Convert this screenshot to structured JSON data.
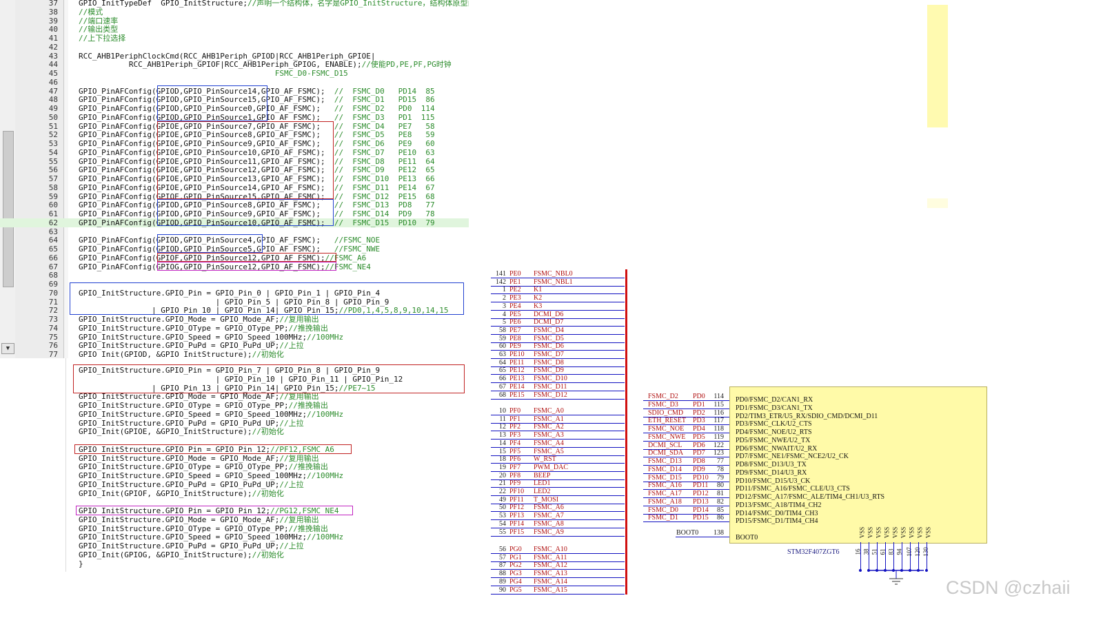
{
  "editor": {
    "lines": [
      {
        "n": "37",
        "code": "GPIO_InitTypeDef  GPIO_InitStructure;",
        "comment": "//声明一个结构体，名字是GPIO_InitStructure，结构体原型由C"
      },
      {
        "n": "38",
        "code": "",
        "comment": "//模式"
      },
      {
        "n": "39",
        "code": "",
        "comment": "//端口速率"
      },
      {
        "n": "40",
        "code": "",
        "comment": "//输出类型"
      },
      {
        "n": "41",
        "code": "",
        "comment": "//上下拉选择"
      },
      {
        "n": "42",
        "code": "",
        "comment": ""
      },
      {
        "n": "43",
        "code": "RCC_AHB1PeriphClockCmd(RCC_AHB1Periph_GPIOD|RCC_AHB1Periph_GPIOE|",
        "comment": ""
      },
      {
        "n": "44",
        "code": "           RCC_AHB1Periph_GPIOF|RCC_AHB1Periph_GPIOG, ENABLE);",
        "comment": "//使能PD,PE,PF,PG时钟"
      },
      {
        "n": "45",
        "code": "",
        "comment": "                                           FSMC_D0-FSMC_D15"
      },
      {
        "n": "46",
        "code": "",
        "comment": ""
      },
      {
        "n": "47",
        "code": "GPIO_PinAFConfig(GPIOD,GPIO_PinSource14,GPIO_AF_FSMC);  ",
        "comment": "//  FSMC_D0   PD14  85"
      },
      {
        "n": "48",
        "code": "GPIO_PinAFConfig(GPIOD,GPIO_PinSource15,GPIO_AF_FSMC);  ",
        "comment": "//  FSMC_D1   PD15  86"
      },
      {
        "n": "49",
        "code": "GPIO_PinAFConfig(GPIOD,GPIO_PinSource0,GPIO_AF_FSMC);   ",
        "comment": "//  FSMC_D2   PD0  114"
      },
      {
        "n": "50",
        "code": "GPIO_PinAFConfig(GPIOD,GPIO_PinSource1,GPIO_AF_FSMC);   ",
        "comment": "//  FSMC_D3   PD1  115"
      },
      {
        "n": "51",
        "code": "GPIO_PinAFConfig(GPIOE,GPIO_PinSource7,GPIO_AF_FSMC);   ",
        "comment": "//  FSMC_D4   PE7   58"
      },
      {
        "n": "52",
        "code": "GPIO_PinAFConfig(GPIOE,GPIO_PinSource8,GPIO_AF_FSMC);   ",
        "comment": "//  FSMC_D5   PE8   59"
      },
      {
        "n": "53",
        "code": "GPIO_PinAFConfig(GPIOE,GPIO_PinSource9,GPIO_AF_FSMC);   ",
        "comment": "//  FSMC_D6   PE9   60"
      },
      {
        "n": "54",
        "code": "GPIO_PinAFConfig(GPIOE,GPIO_PinSource10,GPIO_AF_FSMC);  ",
        "comment": "//  FSMC_D7   PE10  63"
      },
      {
        "n": "55",
        "code": "GPIO_PinAFConfig(GPIOE,GPIO_PinSource11,GPIO_AF_FSMC);  ",
        "comment": "//  FSMC_D8   PE11  64"
      },
      {
        "n": "56",
        "code": "GPIO_PinAFConfig(GPIOE,GPIO_PinSource12,GPIO_AF_FSMC);  ",
        "comment": "//  FSMC_D9   PE12  65"
      },
      {
        "n": "57",
        "code": "GPIO_PinAFConfig(GPIOE,GPIO_PinSource13,GPIO_AF_FSMC);  ",
        "comment": "//  FSMC_D10  PE13  66"
      },
      {
        "n": "58",
        "code": "GPIO_PinAFConfig(GPIOE,GPIO_PinSource14,GPIO_AF_FSMC);  ",
        "comment": "//  FSMC_D11  PE14  67"
      },
      {
        "n": "59",
        "code": "GPIO_PinAFConfig(GPIOE,GPIO_PinSource15,GPIO_AF_FSMC);  ",
        "comment": "//  FSMC_D12  PE15  68"
      },
      {
        "n": "60",
        "code": "GPIO_PinAFConfig(GPIOD,GPIO_PinSource8,GPIO_AF_FSMC);   ",
        "comment": "//  FSMC_D13  PD8   77"
      },
      {
        "n": "61",
        "code": "GPIO_PinAFConfig(GPIOD,GPIO_PinSource9,GPIO_AF_FSMC);   ",
        "comment": "//  FSMC_D14  PD9   78"
      },
      {
        "n": "62",
        "code": "GPIO_PinAFConfig(GPIOD,GPIO_PinSource10,GPIO_AF_FSMC);  ",
        "comment": "//  FSMC_D15  PD10  79"
      },
      {
        "n": "63",
        "code": "",
        "comment": ""
      },
      {
        "n": "64",
        "code": "GPIO_PinAFConfig(GPIOD,GPIO_PinSource4,GPIO_AF_FSMC);   ",
        "comment": "//FSMC_NOE"
      },
      {
        "n": "65",
        "code": "GPIO_PinAFConfig(GPIOD,GPIO_PinSource5,GPIO_AF_FSMC);   ",
        "comment": "//FSMC_NWE"
      },
      {
        "n": "66",
        "code": "GPIO_PinAFConfig(GPIOF,GPIO_PinSource12,GPIO_AF_FSMC);",
        "comment": "//FSMC_A6"
      },
      {
        "n": "67",
        "code": "GPIO_PinAFConfig(GPIOG,GPIO_PinSource12,GPIO_AF_FSMC);",
        "comment": "//FSMC_NE4"
      },
      {
        "n": "68",
        "code": "",
        "comment": ""
      },
      {
        "n": "69",
        "code": "",
        "comment": ""
      },
      {
        "n": "70",
        "code": "GPIO_InitStructure.GPIO_Pin = GPIO_Pin_0 | GPIO_Pin_1 | GPIO_Pin_4",
        "comment": ""
      },
      {
        "n": "71",
        "code": "                              | GPIO_Pin_5 | GPIO_Pin_8 | GPIO_Pin_9",
        "comment": ""
      },
      {
        "n": "72",
        "code": "                | GPIO_Pin_10 | GPIO_Pin_14| GPIO_Pin_15;",
        "comment": "//PD0,1,4,5,8,9,10,14,15"
      },
      {
        "n": "73",
        "code": "GPIO_InitStructure.GPIO_Mode = GPIO_Mode_AF;",
        "comment": "//复用输出"
      },
      {
        "n": "74",
        "code": "GPIO_InitStructure.GPIO_OType = GPIO_OType_PP;",
        "comment": "//推挽输出"
      },
      {
        "n": "75",
        "code": "GPIO_InitStructure.GPIO_Speed = GPIO_Speed_100MHz;",
        "comment": "//100MHz"
      },
      {
        "n": "76",
        "code": "GPIO_InitStructure.GPIO_PuPd = GPIO_PuPd_UP;",
        "comment": "//上拉"
      },
      {
        "n": "77",
        "code": "GPIO_Init(GPIOD, &GPIO_InitStructure);",
        "comment": "//初始化"
      }
    ],
    "current_line": "62"
  },
  "code2": {
    "lines": [
      {
        "code": "GPIO_InitStructure.GPIO_Pin = GPIO_Pin_7 | GPIO_Pin_8 | GPIO_Pin_9",
        "comment": ""
      },
      {
        "code": "                              | GPIO_Pin_10 | GPIO_Pin_11 | GPIO_Pin_12",
        "comment": ""
      },
      {
        "code": "                | GPIO_Pin_13 | GPIO_Pin_14| GPIO_Pin_15;",
        "comment": "//PE7~15"
      },
      {
        "code": "GPIO_InitStructure.GPIO_Mode = GPIO_Mode_AF;",
        "comment": "//复用输出"
      },
      {
        "code": "GPIO_InitStructure.GPIO_OType = GPIO_OType_PP;",
        "comment": "//推挽输出"
      },
      {
        "code": "GPIO_InitStructure.GPIO_Speed = GPIO_Speed_100MHz;",
        "comment": "//100MHz"
      },
      {
        "code": "GPIO_InitStructure.GPIO_PuPd = GPIO_PuPd_UP;",
        "comment": "//上拉"
      },
      {
        "code": "GPIO_Init(GPIOE, &GPIO_InitStructure);",
        "comment": "//初始化"
      },
      {
        "code": "",
        "comment": ""
      },
      {
        "code": "GPIO_InitStructure.GPIO_Pin = GPIO_Pin_12;",
        "comment": "//PF12,FSMC_A6"
      },
      {
        "code": "GPIO_InitStructure.GPIO_Mode = GPIO_Mode_AF;",
        "comment": "//复用输出"
      },
      {
        "code": "GPIO_InitStructure.GPIO_OType = GPIO_OType_PP;",
        "comment": "//推挽输出"
      },
      {
        "code": "GPIO_InitStructure.GPIO_Speed = GPIO_Speed_100MHz;",
        "comment": "//100MHz"
      },
      {
        "code": "GPIO_InitStructure.GPIO_PuPd = GPIO_PuPd_UP;",
        "comment": "//上拉"
      },
      {
        "code": "GPIO_Init(GPIOF, &GPIO_InitStructure);",
        "comment": "//初始化"
      },
      {
        "code": "",
        "comment": ""
      },
      {
        "code": "GPIO_InitStructure.GPIO_Pin = GPIO_Pin_12;",
        "comment": "//PG12,FSMC_NE4"
      },
      {
        "code": "GPIO_InitStructure.GPIO_Mode = GPIO_Mode_AF;",
        "comment": "//复用输出"
      },
      {
        "code": "GPIO_InitStructure.GPIO_OType = GPIO_OType_PP;",
        "comment": "//推挽输出"
      },
      {
        "code": "GPIO_InitStructure.GPIO_Speed = GPIO_Speed_100MHz;",
        "comment": "//100MHz"
      },
      {
        "code": "GPIO_InitStructure.GPIO_PuPd = GPIO_PuPd_UP;",
        "comment": "//上拉"
      },
      {
        "code": "GPIO_Init(GPIOG, &GPIO_InitStructure);",
        "comment": "//初始化"
      },
      {
        "code": "}",
        "comment": ""
      }
    ]
  },
  "schematic_left": {
    "groups": [
      [
        {
          "num": "141",
          "port": "PE0",
          "net": "FSMC_NBL0"
        },
        {
          "num": "142",
          "port": "PE1",
          "net": "FSMC_NBL1"
        },
        {
          "num": "1",
          "port": "PE2",
          "net": "K1"
        },
        {
          "num": "2",
          "port": "PE3",
          "net": "K2"
        },
        {
          "num": "3",
          "port": "PE4",
          "net": "K3"
        },
        {
          "num": "4",
          "port": "PE5",
          "net": "DCMI_D6"
        },
        {
          "num": "5",
          "port": "PE6",
          "net": "DCMI_D7"
        },
        {
          "num": "58",
          "port": "PE7",
          "net": "FSMC_D4"
        },
        {
          "num": "59",
          "port": "PE8",
          "net": "FSMC_D5"
        },
        {
          "num": "60",
          "port": "PE9",
          "net": "FSMC_D6"
        },
        {
          "num": "63",
          "port": "PE10",
          "net": "FSMC_D7"
        },
        {
          "num": "64",
          "port": "PE11",
          "net": "FSMC_D8"
        },
        {
          "num": "65",
          "port": "PE12",
          "net": "FSMC_D9"
        },
        {
          "num": "66",
          "port": "PE13",
          "net": "FSMC_D10"
        },
        {
          "num": "67",
          "port": "PE14",
          "net": "FSMC_D11"
        },
        {
          "num": "68",
          "port": "PE15",
          "net": "FSMC_D12"
        }
      ],
      [
        {
          "num": "10",
          "port": "PF0",
          "net": "FSMC_A0"
        },
        {
          "num": "11",
          "port": "PF1",
          "net": "FSMC_A1"
        },
        {
          "num": "12",
          "port": "PF2",
          "net": "FSMC_A2"
        },
        {
          "num": "13",
          "port": "PF3",
          "net": "FSMC_A3"
        },
        {
          "num": "14",
          "port": "PF4",
          "net": "FSMC_A4"
        },
        {
          "num": "15",
          "port": "PF5",
          "net": "FSMC_A5"
        },
        {
          "num": "18",
          "port": "PF6",
          "net": "W_RST"
        },
        {
          "num": "19",
          "port": "PF7",
          "net": "PWM_DAC"
        },
        {
          "num": "20",
          "port": "PF8",
          "net": "BEEP"
        },
        {
          "num": "21",
          "port": "PF9",
          "net": "LED1"
        },
        {
          "num": "22",
          "port": "PF10",
          "net": "LED2"
        },
        {
          "num": "49",
          "port": "PF11",
          "net": "T_MOSI"
        },
        {
          "num": "50",
          "port": "PF12",
          "net": "FSMC_A6"
        },
        {
          "num": "53",
          "port": "PF13",
          "net": "FSMC_A7"
        },
        {
          "num": "54",
          "port": "PF14",
          "net": "FSMC_A8"
        },
        {
          "num": "55",
          "port": "PF15",
          "net": "FSMC_A9"
        }
      ],
      [
        {
          "num": "56",
          "port": "PG0",
          "net": "FSMC_A10"
        },
        {
          "num": "57",
          "port": "PG1",
          "net": "FSMC_A11"
        },
        {
          "num": "87",
          "port": "PG2",
          "net": "FSMC_A12"
        },
        {
          "num": "88",
          "port": "PG3",
          "net": "FSMC_A13"
        },
        {
          "num": "89",
          "port": "PG4",
          "net": "FSMC_A14"
        },
        {
          "num": "90",
          "port": "PG5",
          "net": "FSMC_A15"
        }
      ]
    ]
  },
  "schematic_right": {
    "nets": [
      {
        "net": "FSMC_D2",
        "port": "PD0",
        "num": "114",
        "func": "PD0/FSMC_D2/CAN1_RX"
      },
      {
        "net": "FSMC_D3",
        "port": "PD1",
        "num": "115",
        "func": "PD1/FSMC_D3/CAN1_TX"
      },
      {
        "net": "SDIO_CMD",
        "port": "PD2",
        "num": "116",
        "func": "PD2/TIM3_ETR/U5_RX/SDIO_CMD/DCMI_D11"
      },
      {
        "net": "ETH_RESET",
        "port": "PD3",
        "num": "117",
        "func": "PD3/FSMC_CLK/U2_CTS"
      },
      {
        "net": "FSMC_NOE",
        "port": "PD4",
        "num": "118",
        "func": "PD4/FSMC_NOE/U2_RTS"
      },
      {
        "net": "FSMC_NWE",
        "port": "PD5",
        "num": "119",
        "func": "PD5/FSMC_NWE/U2_TX"
      },
      {
        "net": "DCMI_SCL",
        "port": "PD6",
        "num": "122",
        "func": "PD6/FSMC_NWAIT/U2_RX"
      },
      {
        "net": "DCMI_SDA",
        "port": "PD7",
        "num": "123",
        "func": "PD7/FSMC_NE1/FSMC_NCE2/U2_CK"
      },
      {
        "net": "FSMC_D13",
        "port": "PD8",
        "num": "77",
        "func": "PD8/FSMC_D13/U3_TX"
      },
      {
        "net": "FSMC_D14",
        "port": "PD9",
        "num": "78",
        "func": "PD9/FSMC_D14/U3_RX"
      },
      {
        "net": "FSMC_D15",
        "port": "PD10",
        "num": "79",
        "func": "PD10/FSMC_D15/U3_CK"
      },
      {
        "net": "FSMC_A16",
        "port": "PD11",
        "num": "80",
        "func": "PD11/FSMC_A16/FSMC_CLE/U3_CTS"
      },
      {
        "net": "FSMC_A17",
        "port": "PD12",
        "num": "81",
        "func": "PD12/FSMC_A17/FSMC_ALE/TIM4_CH1/U3_RTS"
      },
      {
        "net": "FSMC_A18",
        "port": "PD13",
        "num": "82",
        "func": "PD13/FSMC_A18/TIM4_CH2"
      },
      {
        "net": "FSMC_D0",
        "port": "PD14",
        "num": "85",
        "func": "PD14/FSMC_D0/TIM4_CH3"
      },
      {
        "net": "FSMC_D1",
        "port": "PD15",
        "num": "86",
        "func": "PD15/FSMC_D1/TIM4_CH4"
      }
    ],
    "boot": {
      "label": "BOOT0",
      "num": "138",
      "func": "BOOT0"
    },
    "chip_name": "STM32F407ZGT6",
    "vss_label": "VSS",
    "vss_pins": [
      "16",
      "38",
      "51",
      "61",
      "83",
      "94",
      "107",
      "120",
      "130"
    ]
  },
  "watermark": "CSDN @czhaii",
  "colors": {
    "comment": "#2c8c2c",
    "net": "#b01010",
    "wire": "#1010c0",
    "bus": "#d01010",
    "chip": "#fffaa8",
    "highlight_blue": "#2040d0",
    "highlight_red": "#c02020",
    "highlight_magenta": "#c020c0"
  }
}
